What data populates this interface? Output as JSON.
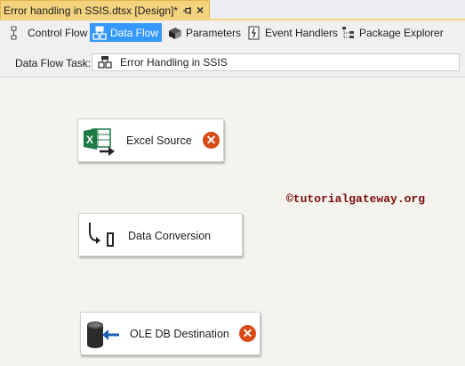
{
  "document_tab": {
    "title": "Error handling in SSIS.dtsx [Design]*",
    "close_glyph": "×",
    "pin_icon": "pin-icon",
    "tab_color": "#f4d37f"
  },
  "toolbar": {
    "items": [
      {
        "label": "Control Flow",
        "icon": "control-flow-icon",
        "active": false
      },
      {
        "label": "Data Flow",
        "icon": "data-flow-icon",
        "active": true
      },
      {
        "label": "Parameters",
        "icon": "parameters-icon",
        "active": false
      },
      {
        "label": "Event Handlers",
        "icon": "event-handlers-icon",
        "active": false
      },
      {
        "label": "Package Explorer",
        "icon": "package-explorer-icon",
        "active": false
      }
    ],
    "active_color": "#3399ff"
  },
  "data_flow_task": {
    "label": "Data Flow Task:",
    "selected": "Error Handling in SSIS",
    "icon": "data-flow-task-icon"
  },
  "components": [
    {
      "name": "Excel Source",
      "icon": "excel-source-icon",
      "has_error": true,
      "error_glyph": "✕"
    },
    {
      "name": "Data Conversion",
      "icon": "data-conversion-icon",
      "has_error": false
    },
    {
      "name": "OLE DB Destination",
      "icon": "ole-db-destination-icon",
      "has_error": true,
      "error_glyph": "✕"
    }
  ],
  "error_badge_color": "#d64b16",
  "watermark": "©tutorialgateway.org"
}
